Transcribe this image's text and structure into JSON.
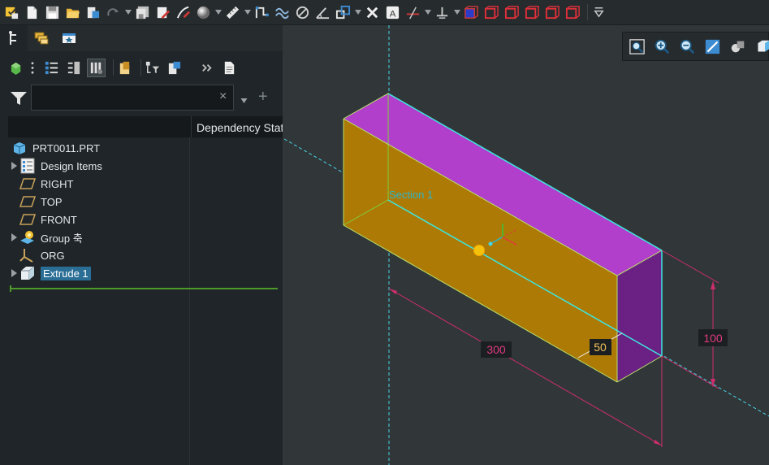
{
  "toolbar": {
    "icons": [
      "regenerate-icon",
      "new-icon",
      "save-icon",
      "open-icon",
      "options-icon",
      "redo-icon",
      "save-as-icon",
      "edit-definition-icon",
      "sketch-icon",
      "appearance-sphere-icon",
      "measure-icon",
      "datum-point-icon",
      "curve-icon",
      "cancel-icon",
      "angle-icon",
      "orient-icon",
      "close-window-icon",
      "annotation-icon",
      "axis-icon",
      "datum-plane-icon",
      "view-box-icons",
      "more-icon"
    ]
  },
  "left_panel": {
    "tabs": [
      "model-tree-tab",
      "layers-tab",
      "favorites-tab"
    ],
    "filter": {
      "value": "",
      "placeholder": "",
      "clear": "×",
      "add": "+"
    },
    "columns": [
      "",
      "Dependency Status"
    ],
    "tree": [
      {
        "label": "PRT0011.PRT",
        "icon": "part-icon",
        "expandable": false,
        "selected": false
      },
      {
        "label": "Design Items",
        "icon": "design-items-icon",
        "expandable": true,
        "selected": false
      },
      {
        "label": "RIGHT",
        "icon": "datum-plane-icon",
        "expandable": false,
        "selected": false
      },
      {
        "label": "TOP",
        "icon": "datum-plane-icon",
        "expandable": false,
        "selected": false
      },
      {
        "label": "FRONT",
        "icon": "datum-plane-icon",
        "expandable": false,
        "selected": false
      },
      {
        "label": "Group 축",
        "icon": "group-icon",
        "expandable": true,
        "selected": false
      },
      {
        "label": "ORG",
        "icon": "coordinate-system-icon",
        "expandable": false,
        "selected": false
      },
      {
        "label": "Extrude 1",
        "icon": "extrude-icon",
        "expandable": true,
        "selected": true
      }
    ]
  },
  "viewport": {
    "view_toolbar": [
      "refit-icon",
      "zoom-in-icon",
      "zoom-out-icon",
      "repaint-icon",
      "display-style-icon",
      "saved-views-icon"
    ],
    "section_label": "Section 1",
    "dimensions": {
      "length": "300",
      "width": "50",
      "height": "100"
    },
    "colors": {
      "top_face": "#b13fcb",
      "front_face": "#ad7a06",
      "side_face": "#6a2183",
      "edge": "#3ce6e1",
      "dimension": "#ce2e6e",
      "background": "#313638"
    }
  }
}
